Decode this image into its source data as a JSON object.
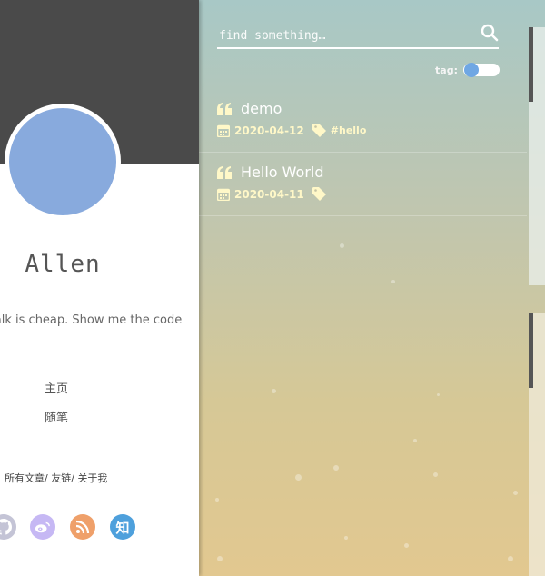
{
  "sidebar": {
    "author_name": "Allen",
    "motto": "Talk is cheap. Show me the code",
    "nav": [
      {
        "label": "主页"
      },
      {
        "label": "随笔"
      }
    ],
    "footer_links": [
      {
        "label": "所有文章"
      },
      {
        "label": "友链"
      },
      {
        "label": "关于我"
      }
    ],
    "footer_separator": "/",
    "social": [
      {
        "name": "github",
        "icon": "github-icon",
        "color": "#c4c4d6"
      },
      {
        "name": "weibo",
        "icon": "weibo-icon",
        "color": "#c6b8f4"
      },
      {
        "name": "rss",
        "icon": "rss-icon",
        "color": "#efa06a"
      },
      {
        "name": "zhihu",
        "icon": "zhihu-icon",
        "label": "知",
        "color": "#4ea0dc"
      }
    ]
  },
  "search": {
    "placeholder": "find something…",
    "icon": "search-icon"
  },
  "tag_toggle": {
    "label": "tag:",
    "enabled": false
  },
  "posts": [
    {
      "title": "demo",
      "date": "2020-04-12",
      "tag": "#hello"
    },
    {
      "title": "Hello World",
      "date": "2020-04-11",
      "tag": ""
    }
  ],
  "colors": {
    "banner": "#4a4a4a",
    "avatar": "#88aadd",
    "meta_text": "#fff8c8",
    "toggle_knob": "#6fa7e4"
  }
}
